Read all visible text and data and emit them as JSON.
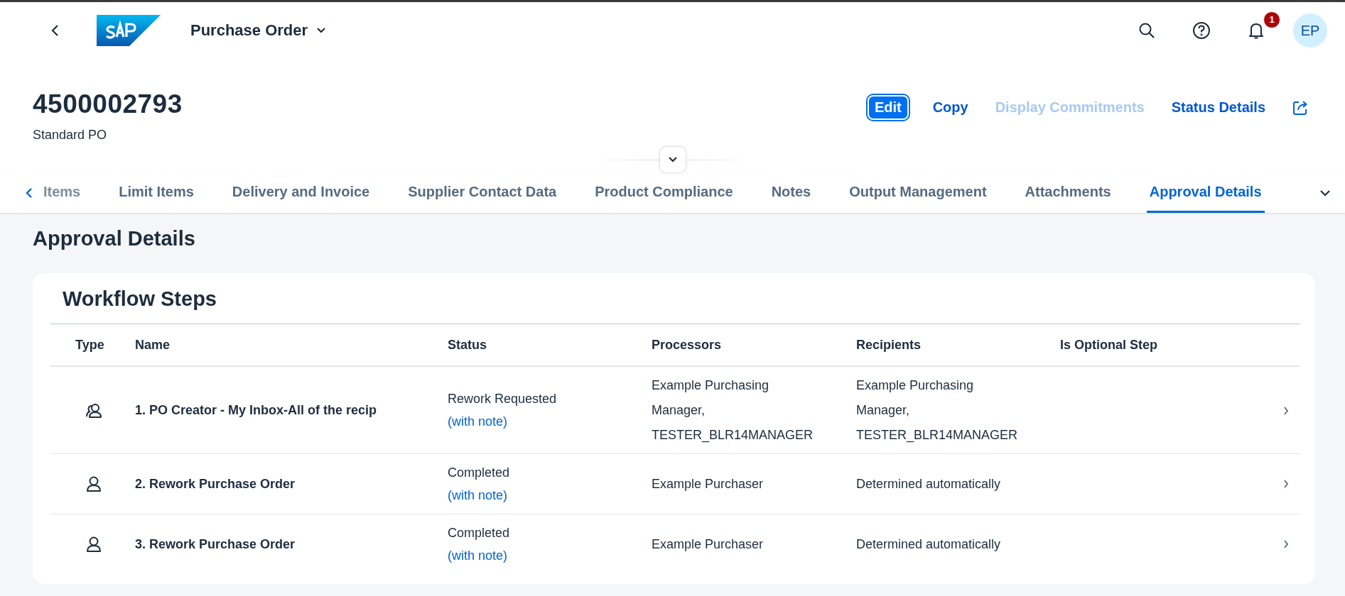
{
  "shell": {
    "title": "Purchase Order",
    "notification_count": "1",
    "avatar_initials": "EP"
  },
  "object_header": {
    "title": "4500002793",
    "subtitle": "Standard PO",
    "actions": [
      {
        "label": "Edit",
        "kind": "emphasized",
        "disabled": false
      },
      {
        "label": "Copy",
        "kind": "link",
        "disabled": false
      },
      {
        "label": "Display Commitments",
        "kind": "link",
        "disabled": true
      },
      {
        "label": "Status Details",
        "kind": "link",
        "disabled": false
      }
    ]
  },
  "tabs": [
    {
      "label": "Items",
      "selected": false
    },
    {
      "label": "Limit Items",
      "selected": false
    },
    {
      "label": "Delivery and Invoice",
      "selected": false
    },
    {
      "label": "Supplier Contact Data",
      "selected": false
    },
    {
      "label": "Product Compliance",
      "selected": false
    },
    {
      "label": "Notes",
      "selected": false
    },
    {
      "label": "Output Management",
      "selected": false
    },
    {
      "label": "Attachments",
      "selected": false
    },
    {
      "label": "Approval Details",
      "selected": true
    }
  ],
  "section_title": "Approval Details",
  "workflow": {
    "title": "Workflow Steps",
    "columns": [
      "Type",
      "Name",
      "Status",
      "Processors",
      "Recipients",
      "Is Optional Step"
    ],
    "rows": [
      {
        "kind": "group",
        "name": "1. PO Creator - My Inbox-All of the recip",
        "status": "Rework Requested",
        "status_note": "(with note)",
        "processors": "Example Purchasing Manager, TESTER_BLR14MANAGER",
        "recipients": "Example Purchasing Manager, TESTER_BLR14MANAGER"
      },
      {
        "kind": "user",
        "name": "2. Rework Purchase Order",
        "status": "Completed",
        "status_note": "(with note)",
        "processors": "Example Purchaser",
        "recipients": "Determined automatically"
      },
      {
        "kind": "user",
        "name": "3. Rework Purchase Order",
        "status": "Completed",
        "status_note": "(with note)",
        "processors": "Example Purchaser",
        "recipients": "Determined automatically"
      }
    ]
  }
}
